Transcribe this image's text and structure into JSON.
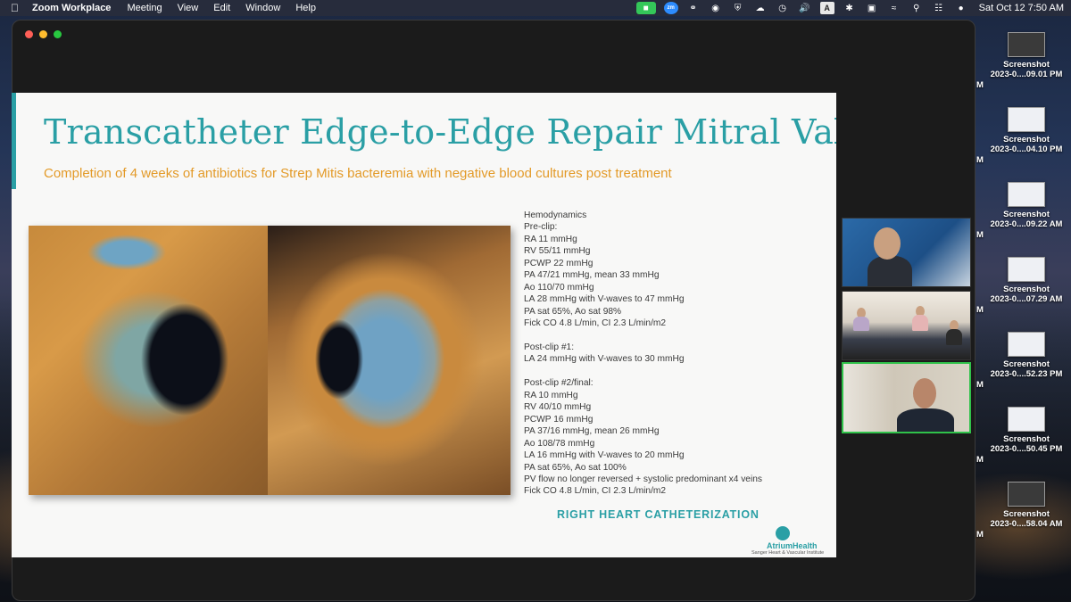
{
  "menubar": {
    "app": "Zoom Workplace",
    "menus": [
      "Meeting",
      "View",
      "Edit",
      "Window",
      "Help"
    ],
    "keyboard": "A",
    "clock": "Sat Oct 12  7:50 AM",
    "icons": [
      "apple-icon",
      "zoom-video-icon",
      "zoom-icon",
      "creative-cloud-icon",
      "globe-icon",
      "shield-icon",
      "cloud-icon",
      "clock-icon",
      "volume-icon",
      "keyboard-icon",
      "bluetooth-icon",
      "battery-icon",
      "wifi-icon",
      "search-icon",
      "control-center-icon",
      "siri-icon"
    ]
  },
  "slide": {
    "title": "Transcatheter Edge-to-Edge Repair Mitral Valve...",
    "subtitle": "Completion of 4 weeks of antibiotics for Strep Mitis bacteremia with negative blood cultures post treatment",
    "hemodynamics": "Hemodynamics\nPre-clip:\nRA 11 mmHg\nRV 55/11 mmHg\nPCWP 22 mmHg\nPA 47/21 mmHg, mean 33 mmHg\nAo 110/70 mmHg\nLA 28 mmHg with V-waves to 47 mmHg\nPA sat 65%, Ao sat 98%\nFick CO 4.8 L/min, CI 2.3 L/min/m2\n\nPost-clip #1:\nLA 24 mmHg with V-waves to 30 mmHg\n\nPost-clip #2/final:\nRA 10 mmHg\nRV 40/10 mmHg\nPCWP 16 mmHg\nPA 37/16 mmHg, mean 26 mmHg\nAo 108/78 mmHg\nLA 16 mmHg with V-waves to 20 mmHg\nPA sat 65%, Ao sat 100%\nPV flow no longer reversed + systolic predominant x4 veins\nFick CO 4.8 L/min, CI 2.3 L/min/m2",
    "section_label": "RIGHT HEART CATHETERIZATION",
    "logo_name": "AtriumHealth",
    "logo_sub": "Sanger Heart & Vascular Institute",
    "accent": "#2a9fa5",
    "subtitle_color": "#e39a28"
  },
  "desktop": {
    "screenshots": [
      {
        "name": "Screenshot",
        "date": "2023-0....09.01 PM"
      },
      {
        "name": "Screenshot",
        "date": "2023-0....04.10 PM"
      },
      {
        "name": "Screenshot",
        "date": "2023-0....09.22 AM"
      },
      {
        "name": "Screenshot",
        "date": "2023-0....07.29 AM"
      },
      {
        "name": "Screenshot",
        "date": "2023-0....52.23 PM"
      },
      {
        "name": "Screenshot",
        "date": "2023-0....50.45 PM"
      },
      {
        "name": "Screenshot",
        "date": "2023-0....58.04 AM"
      }
    ],
    "edge_letter": "M"
  }
}
